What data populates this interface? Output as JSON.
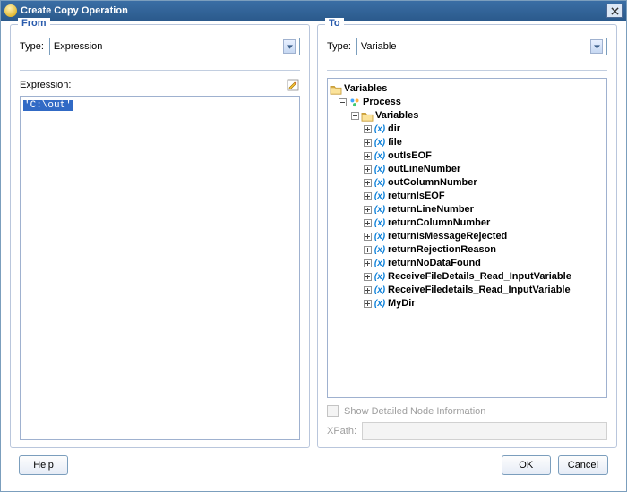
{
  "window": {
    "title": "Create Copy Operation"
  },
  "from": {
    "legend": "From",
    "type_label": "Type:",
    "type_value": "Expression",
    "expression_label": "Expression:",
    "expression_value": "'C:\\out'"
  },
  "to": {
    "legend": "To",
    "type_label": "Type:",
    "type_value": "Variable",
    "tree": {
      "root": "Variables",
      "process": "Process",
      "inner_variables": "Variables",
      "items": [
        "dir",
        "file",
        "outIsEOF",
        "outLineNumber",
        "outColumnNumber",
        "returnIsEOF",
        "returnLineNumber",
        "returnColumnNumber",
        "returnIsMessageRejected",
        "returnRejectionReason",
        "returnNoDataFound",
        "ReceiveFileDetails_Read_InputVariable",
        "ReceiveFiledetails_Read_InputVariable",
        "MyDir"
      ]
    },
    "detail_checkbox": "Show Detailed Node Information",
    "xpath_label": "XPath:"
  },
  "buttons": {
    "help": "Help",
    "ok": "OK",
    "cancel": "Cancel"
  }
}
